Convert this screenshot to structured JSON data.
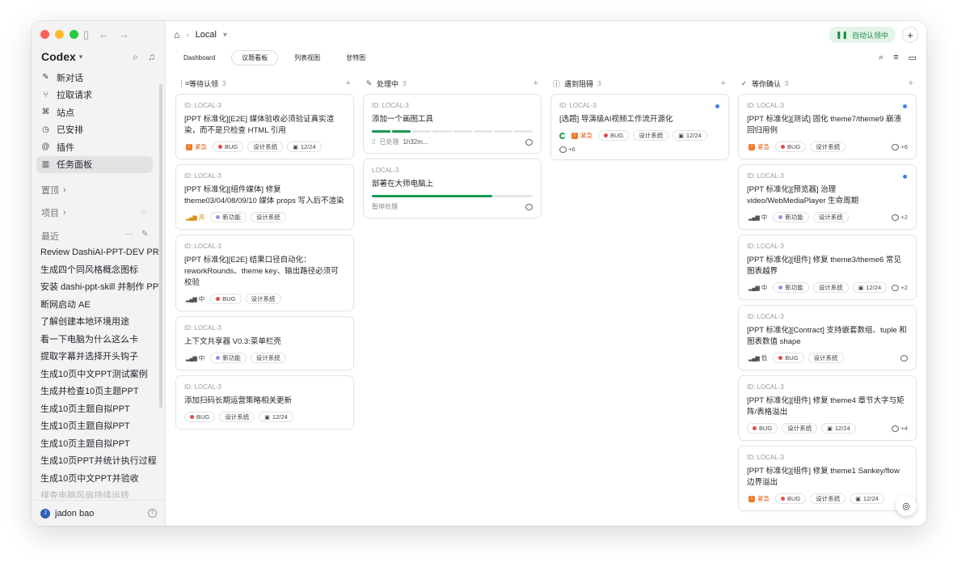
{
  "sidebar": {
    "brand": "Codex",
    "nav": [
      {
        "label": "新对话",
        "icon": "edit-icon"
      },
      {
        "label": "拉取请求",
        "icon": "pull-request-icon"
      },
      {
        "label": "站点",
        "icon": "sites-icon"
      },
      {
        "label": "已安排",
        "icon": "clock-icon"
      },
      {
        "label": "插件",
        "icon": "plugin-icon"
      },
      {
        "label": "任务面板",
        "icon": "board-icon"
      }
    ],
    "pinned_label": "置顶",
    "projects_label": "项目",
    "recent_label": "最近",
    "recent": [
      "Review DashiAI-PPT-DEV PR",
      "生成四个同风格概念图标",
      "安装 dashi-ppt-skill 并制作 PPT",
      "断网启动 AE",
      "了解创建本地环境用途",
      "看一下电脑为什么这么卡",
      "提取字幕并选择开头钩子",
      "生成10页中文PPT测试案例",
      "生成并检查10页主题PPT",
      "生成10页主题自拟PPT",
      "生成10页主题自拟PPT",
      "生成10页主题自拟PPT",
      "生成10页PPT并统计执行过程",
      "生成10页中文PPT并验收",
      "排查电脑风扇持续运转"
    ],
    "user_name": "jadon bao",
    "user_initial": "J"
  },
  "topbar": {
    "breadcrumb": "Local",
    "auto_label": "自动认领中"
  },
  "tabs": [
    "Dashboard",
    "议题看板",
    "列表视图",
    "甘特图"
  ],
  "columns": [
    {
      "title": "等待认领",
      "count": "3",
      "cards": [
        {
          "id": "ID: LOCAL-3",
          "title": "[PPT 标准化][E2E] 媒体验收必须验证真实渲染，而不是只检查 HTML 引用",
          "priority": "紧急",
          "tags": [
            "BUG",
            "设计系统"
          ],
          "date": "12/24"
        },
        {
          "id": "ID: LOCAL-3",
          "title": "[PPT 标准化][组件媒体] 修复 theme03/04/08/09/10 媒体 props 写入后不渲染",
          "priority": "高",
          "tags": [
            "新功能",
            "设计系统"
          ]
        },
        {
          "id": "ID: LOCAL-3",
          "title": "[PPT 标准化][E2E] 结果口径自动化：reworkRounds、theme key、输出路径必须可校验",
          "priority": "中",
          "tags": [
            "BUG",
            "设计系统"
          ]
        },
        {
          "id": "ID: LOCAL-3",
          "title": "上下文共享器 V0.3:菜单栏壳",
          "priority": "中",
          "tags": [
            "新功能",
            "设计系统"
          ]
        },
        {
          "id": "ID: LOCAL-3",
          "title": "添加扫码长期运营策略相关更新",
          "tags": [
            "BUG",
            "设计系统"
          ],
          "date": "12/24"
        }
      ]
    },
    {
      "title": "处理中",
      "count": "3",
      "cards": [
        {
          "id": "ID: LOCAL-3",
          "title": "添加一个画图工具",
          "progress_segments": 8,
          "progress_on": 2,
          "meta_label": "已处理",
          "meta_value": "1h32m..."
        },
        {
          "id": "LOCAL-3",
          "title": "部署在大师电脑上",
          "progress": 0.75,
          "meta_label": "暂停处理"
        }
      ]
    },
    {
      "title": "遇到阻碍",
      "count": "3",
      "cards": [
        {
          "id": "ID: LOCAL-3",
          "title": "[选题] 导演级AI视频工作流开源化",
          "priority": "紧急",
          "tags": [
            "BUG",
            "设计系统"
          ],
          "date": "12/24",
          "comments": "+6",
          "unread": true
        }
      ]
    },
    {
      "title": "等你确认",
      "count": "3",
      "cards": [
        {
          "id": "ID: LOCAL-3",
          "title": "[PPT 标准化][测试] 固化 theme7/theme9 崩溃回归用例",
          "priority": "紧急",
          "tags": [
            "BUG",
            "设计系统"
          ],
          "comments": "+6",
          "unread": true
        },
        {
          "id": "ID: LOCAL-3",
          "title": "[PPT 标准化][预览器] 治理 video/WebMediaPlayer 生命周期",
          "priority": "中",
          "tags": [
            "新功能",
            "设计系统"
          ],
          "comments": "+2",
          "unread": true
        },
        {
          "id": "ID: LOCAL-3",
          "title": "[PPT 标准化][组件] 修复 theme3/theme6 常见图表越界",
          "priority": "中",
          "tags": [
            "新功能",
            "设计系统"
          ],
          "date": "12/24",
          "comments": "+2"
        },
        {
          "id": "ID: LOCAL-3",
          "title": "[PPT 标准化][Contract] 支持嵌套数组、tuple 和图表数值 shape",
          "priority": "低",
          "tags": [
            "BUG",
            "设计系统"
          ],
          "comments": ""
        },
        {
          "id": "ID: LOCAL-3",
          "title": "[PPT 标准化][组件] 修复 theme4 章节大字与矩阵/表格溢出",
          "tags": [
            "BUG",
            "设计系统"
          ],
          "date": "12/24",
          "comments": "+4"
        },
        {
          "id": "ID: LOCAL-3",
          "title": "[PPT 标准化][组件] 修复 theme1 Sankey/flow 边界溢出",
          "priority": "紧急",
          "tags": [
            "BUG",
            "设计系统"
          ],
          "date": "12/24"
        }
      ]
    }
  ]
}
